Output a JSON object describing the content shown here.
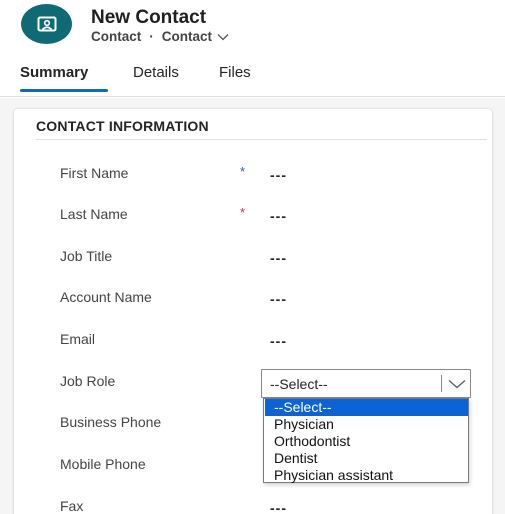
{
  "header": {
    "avatar_icon": "contact-card-icon",
    "title": "New Contact",
    "breadcrumb": {
      "entity": "Contact",
      "separator": "·",
      "form": "Contact"
    }
  },
  "tabs": [
    {
      "label": "Summary",
      "active": true
    },
    {
      "label": "Details",
      "active": false
    },
    {
      "label": "Files",
      "active": false
    }
  ],
  "section": {
    "title": "CONTACT INFORMATION",
    "fields": [
      {
        "label": "First Name",
        "required_marker": "*",
        "value": "---"
      },
      {
        "label": "Last Name",
        "required_marker": "*",
        "value": "---"
      },
      {
        "label": "Job Title",
        "value": "---"
      },
      {
        "label": "Account Name",
        "value": "---"
      },
      {
        "label": "Email",
        "value": "---"
      },
      {
        "label": "Job Role"
      },
      {
        "label": "Business Phone"
      },
      {
        "label": "Mobile Phone"
      },
      {
        "label": "Fax",
        "value": "---"
      }
    ]
  },
  "job_role_select": {
    "selected_value": "--Select--",
    "options": [
      "--Select--",
      "Physician",
      "Orthodontist",
      "Dentist",
      "Physician assistant"
    ],
    "highlighted_index": 0
  },
  "colors": {
    "avatar_bg": "#0e6b73",
    "tab_accent": "#0f6cbd",
    "recommended_marker": "#2e59d9",
    "required_marker": "#c4314b",
    "option_highlight": "#0c63d4"
  }
}
